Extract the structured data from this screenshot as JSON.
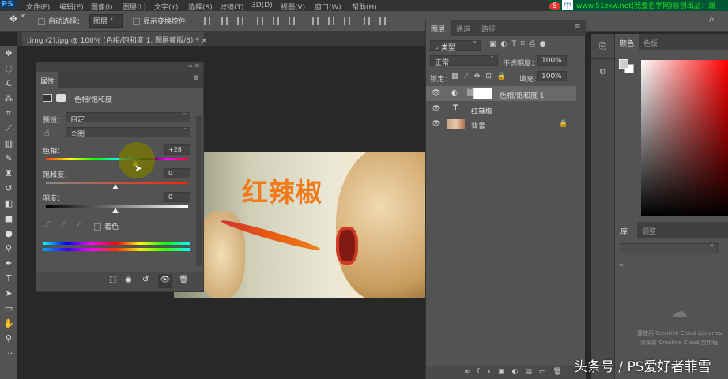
{
  "app": {
    "logo": "PS"
  },
  "menu": [
    "文件(F)",
    "编辑(E)",
    "图像(I)",
    "图层(L)",
    "文字(Y)",
    "选择(S)",
    "滤镜(T)",
    "3D(D)",
    "视图(V)",
    "窗口(W)",
    "帮助(H)"
  ],
  "ime": {
    "s": "S",
    "zh": "中",
    "url": "www.51zxw.net(我要自学网)原创出品：漏"
  },
  "options": {
    "auto_select_label": "自动选择：",
    "auto_select_value": "图层",
    "show_transform_label": "显示变换控件"
  },
  "document_tab": {
    "title": "timg (2).jpg @ 100% (色相/饱和度 1, 图层蒙版/8) *",
    "close": "×"
  },
  "canvas": {
    "text_layer": "红辣椒"
  },
  "properties": {
    "tab": "属性",
    "adjust_name": "色相/饱和度",
    "preset_label": "预设：",
    "preset_value": "自定",
    "range_value": "全图",
    "hue_label": "色相：",
    "hue_value": "+28",
    "hue": 28,
    "saturation_label": "饱和度：",
    "saturation_value": "0",
    "lightness_label": "明度：",
    "lightness_value": "0",
    "colorize_label": "着色"
  },
  "layers_panel": {
    "tabs": [
      "图层",
      "通道",
      "路径"
    ],
    "filter": "类型",
    "blend_mode": "正常",
    "opacity_label": "不透明度：",
    "opacity": "100%",
    "lock_label": "锁定：",
    "fill_label": "填充：",
    "fill": "100%",
    "layers": [
      {
        "name": "色相/饱和度 1",
        "type": "adjustment",
        "selected": true
      },
      {
        "name": "红辣椒",
        "type": "text"
      },
      {
        "name": "背景",
        "type": "image",
        "locked": true
      }
    ]
  },
  "color_panel": {
    "tabs": [
      "颜色",
      "色板"
    ]
  },
  "library_panel": {
    "tabs": [
      "库",
      "调整"
    ],
    "msg1": "要使用 Creative Cloud Libraries",
    "msg2": "请安装 Creative Cloud 应用程"
  },
  "watermark": "头条号 / PS爱好者菲雪"
}
